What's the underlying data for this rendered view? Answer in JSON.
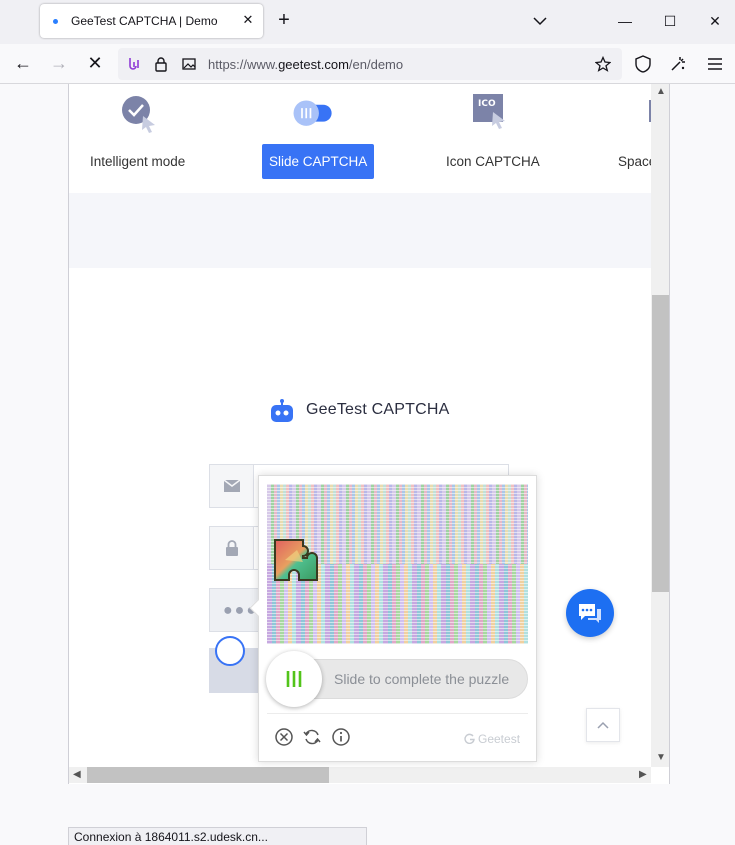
{
  "browser": {
    "tab_title": "GeeTest CAPTCHA | Demo",
    "url_prefix": "https://www.",
    "url_domain": "geetest.com",
    "url_path": "/en/demo",
    "status_text": "Connexion à 1864011.s2.udesk.cn..."
  },
  "modes": [
    {
      "label": "Intelligent mode",
      "icon": "check-cursor-icon"
    },
    {
      "label": "Slide CAPTCHA",
      "icon": "slider-toggle-icon",
      "active": true
    },
    {
      "label": "Icon CAPTCHA",
      "icon": "ico-cursor-icon"
    },
    {
      "label": "Space",
      "icon": "space-icon"
    }
  ],
  "brand": {
    "name": "GeeTest CAPTCHA"
  },
  "captcha": {
    "slider_hint": "Slide to complete the puzzle",
    "provider": "Geetest"
  },
  "colors": {
    "accent": "#3873f5",
    "chat": "#1d6ff2",
    "slider_green": "#52c41a"
  }
}
